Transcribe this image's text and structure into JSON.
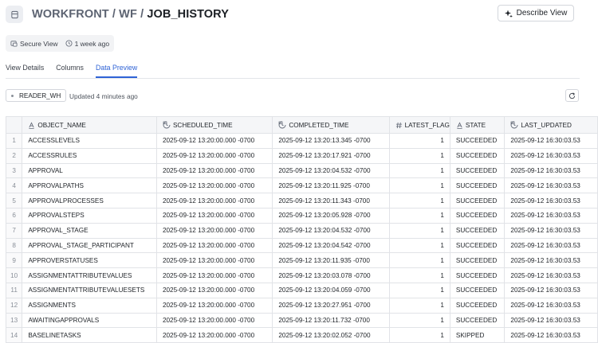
{
  "header": {
    "db": "WORKFRONT",
    "schema": "WF",
    "object": "JOB_HISTORY",
    "sep": "/",
    "describe_label": "Describe View"
  },
  "meta": {
    "type_label": "Secure View",
    "age_label": "1 week ago"
  },
  "tabs": [
    "View Details",
    "Columns",
    "Data Preview"
  ],
  "active_tab": "Data Preview",
  "toolbar": {
    "warehouse": "READER_WH",
    "updated": "Updated 4 minutes ago"
  },
  "table": {
    "columns": [
      {
        "name": "OBJECT_NAME",
        "icon": "text-type-icon"
      },
      {
        "name": "SCHEDULED_TIME",
        "icon": "clock-type-icon"
      },
      {
        "name": "COMPLETED_TIME",
        "icon": "clock-type-icon"
      },
      {
        "name": "LATEST_FLAG",
        "icon": "number-type-icon"
      },
      {
        "name": "STATE",
        "icon": "text-type-icon"
      },
      {
        "name": "LAST_UPDATED",
        "icon": "clock-type-icon"
      }
    ],
    "rows": [
      [
        "1",
        "ACCESSLEVELS",
        "2025-09-12 13:20:00.000 -0700",
        "2025-09-12 13:20:13.345 -0700",
        "1",
        "SUCCEEDED",
        "2025-09-12 16:30:03.53"
      ],
      [
        "2",
        "ACCESSRULES",
        "2025-09-12 13:20:00.000 -0700",
        "2025-09-12 13:20:17.921 -0700",
        "1",
        "SUCCEEDED",
        "2025-09-12 16:30:03.53"
      ],
      [
        "3",
        "APPROVAL",
        "2025-09-12 13:20:00.000 -0700",
        "2025-09-12 13:20:04.532 -0700",
        "1",
        "SUCCEEDED",
        "2025-09-12 16:30:03.53"
      ],
      [
        "4",
        "APPROVALPATHS",
        "2025-09-12 13:20:00.000 -0700",
        "2025-09-12 13:20:11.925 -0700",
        "1",
        "SUCCEEDED",
        "2025-09-12 16:30:03.53"
      ],
      [
        "5",
        "APPROVALPROCESSES",
        "2025-09-12 13:20:00.000 -0700",
        "2025-09-12 13:20:11.343 -0700",
        "1",
        "SUCCEEDED",
        "2025-09-12 16:30:03.53"
      ],
      [
        "6",
        "APPROVALSTEPS",
        "2025-09-12 13:20:00.000 -0700",
        "2025-09-12 13:20:05.928 -0700",
        "1",
        "SUCCEEDED",
        "2025-09-12 16:30:03.53"
      ],
      [
        "7",
        "APPROVAL_STAGE",
        "2025-09-12 13:20:00.000 -0700",
        "2025-09-12 13:20:04.532 -0700",
        "1",
        "SUCCEEDED",
        "2025-09-12 16:30:03.53"
      ],
      [
        "8",
        "APPROVAL_STAGE_PARTICIPANT",
        "2025-09-12 13:20:00.000 -0700",
        "2025-09-12 13:20:04.542 -0700",
        "1",
        "SUCCEEDED",
        "2025-09-12 16:30:03.53"
      ],
      [
        "9",
        "APPROVERSTATUSES",
        "2025-09-12 13:20:00.000 -0700",
        "2025-09-12 13:20:11.935 -0700",
        "1",
        "SUCCEEDED",
        "2025-09-12 16:30:03.53"
      ],
      [
        "10",
        "ASSIGNMENTATTRIBUTEVALUES",
        "2025-09-12 13:20:00.000 -0700",
        "2025-09-12 13:20:03.078 -0700",
        "1",
        "SUCCEEDED",
        "2025-09-12 16:30:03.53"
      ],
      [
        "11",
        "ASSIGNMENTATTRIBUTEVALUESETS",
        "2025-09-12 13:20:00.000 -0700",
        "2025-09-12 13:20:04.059 -0700",
        "1",
        "SUCCEEDED",
        "2025-09-12 16:30:03.53"
      ],
      [
        "12",
        "ASSIGNMENTS",
        "2025-09-12 13:20:00.000 -0700",
        "2025-09-12 13:20:27.951 -0700",
        "1",
        "SUCCEEDED",
        "2025-09-12 16:30:03.53"
      ],
      [
        "13",
        "AWAITINGAPPROVALS",
        "2025-09-12 13:20:00.000 -0700",
        "2025-09-12 13:20:11.732 -0700",
        "1",
        "SUCCEEDED",
        "2025-09-12 16:30:03.53"
      ],
      [
        "14",
        "BASELINETASKS",
        "2025-09-12 13:20:00.000 -0700",
        "2025-09-12 13:20:02.052 -0700",
        "1",
        "SKIPPED",
        "2025-09-12 16:30:03.53"
      ]
    ]
  },
  "colors": {
    "accent": "#2f63d6",
    "header_bg": "#f5f6f8",
    "border": "#e1e3e7"
  }
}
